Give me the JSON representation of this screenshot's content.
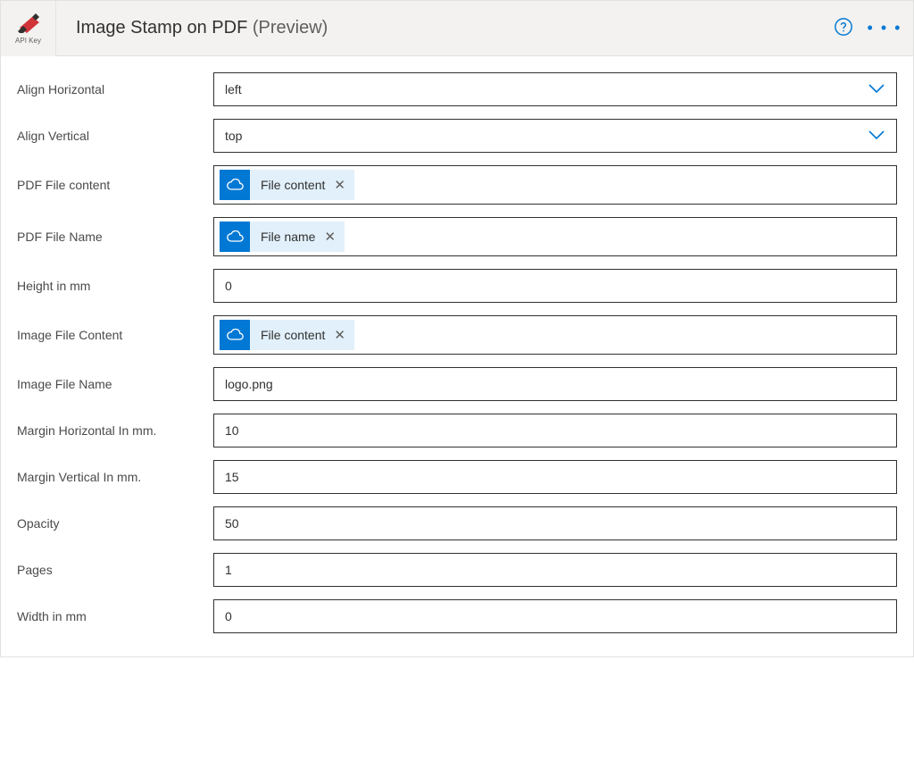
{
  "header": {
    "icon_caption": "API Key",
    "title": "Image Stamp on PDF",
    "suffix": "(Preview)"
  },
  "fields": {
    "align_horizontal": {
      "label": "Align Horizontal",
      "value": "left"
    },
    "align_vertical": {
      "label": "Align Vertical",
      "value": "top"
    },
    "pdf_content": {
      "label": "PDF File content",
      "token": "File content"
    },
    "pdf_name": {
      "label": "PDF File Name",
      "token": "File name"
    },
    "height_mm": {
      "label": "Height in mm",
      "value": "0"
    },
    "img_content": {
      "label": "Image File Content",
      "token": "File content"
    },
    "img_name": {
      "label": "Image File Name",
      "value": "logo.png"
    },
    "margin_h": {
      "label": "Margin Horizontal In mm.",
      "value": "10"
    },
    "margin_v": {
      "label": "Margin Vertical In mm.",
      "value": "15"
    },
    "opacity": {
      "label": "Opacity",
      "value": "50"
    },
    "pages": {
      "label": "Pages",
      "value": "1"
    },
    "width_mm": {
      "label": "Width in mm",
      "value": "0"
    }
  }
}
